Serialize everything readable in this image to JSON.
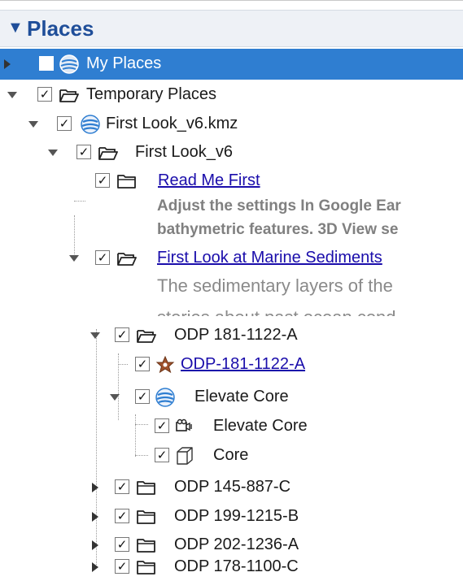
{
  "panel": {
    "title": "Places",
    "expand_icon": "triangle-down-icon"
  },
  "tree": {
    "my_places": {
      "label": "My Places",
      "checked": false,
      "icon": "earth-globe-icon"
    },
    "temporary_places": {
      "label": "Temporary Places",
      "checked": true,
      "icon": "open-folder-icon"
    },
    "first_look_kmz": {
      "label": "First Look_v6.kmz",
      "checked": true,
      "icon": "earth-globe-icon"
    },
    "first_look_v6": {
      "label": "First Look_v6",
      "checked": true,
      "icon": "open-folder-icon"
    },
    "read_me_first": {
      "label": "Read Me First",
      "checked": true,
      "icon": "closed-folder-icon",
      "desc_line1": "Adjust the settings In Google Ear",
      "desc_line2": "bathymetric features. 3D View se"
    },
    "marine_sediments": {
      "label": "First Look at Marine Sediments",
      "checked": true,
      "icon": "open-folder-icon",
      "desc_line1": "The sedimentary layers of the",
      "desc_line2": "stories about past ocean cond"
    },
    "odp_1122_folder": {
      "label": "ODP 181-1122-A",
      "checked": true,
      "icon": "open-folder-icon"
    },
    "odp_1122_placemark": {
      "label": "ODP-181-1122-A",
      "checked": true,
      "icon": "star-placemark-icon"
    },
    "elevate_core_folder": {
      "label": "Elevate Core",
      "checked": true,
      "icon": "earth-globe-icon"
    },
    "elevate_core_tour": {
      "label": "Elevate Core",
      "checked": true,
      "icon": "tour-camera-icon"
    },
    "core": {
      "label": "Core",
      "checked": true,
      "icon": "3d-model-cube-icon"
    },
    "odp_887": {
      "label": "ODP 145-887-C",
      "checked": true,
      "icon": "closed-folder-icon"
    },
    "odp_1215": {
      "label": "ODP 199-1215-B",
      "checked": true,
      "icon": "closed-folder-icon"
    },
    "odp_1236": {
      "label": "ODP 202-1236-A",
      "checked": true,
      "icon": "closed-folder-icon"
    },
    "odp_1100": {
      "label": "ODP 178-1100-C",
      "checked": true,
      "icon": "closed-folder-icon"
    }
  },
  "colors": {
    "selection": "#2f7ed1",
    "header_text": "#1f4e99",
    "link": "#1a0dab"
  }
}
